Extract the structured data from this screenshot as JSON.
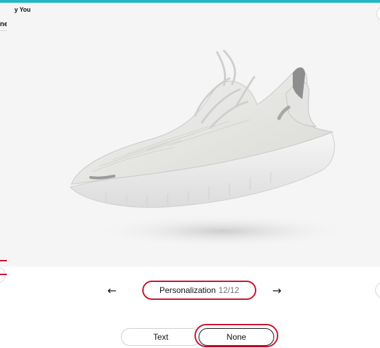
{
  "viewer": {
    "title": "y You",
    "right_control_glyph": "↺"
  },
  "left_panel": {
    "cropped_text": "ne"
  },
  "pager": {
    "prev_glyph": "←",
    "next_glyph": "→",
    "section_label": "Personalization",
    "section_count": "12/12"
  },
  "options": {
    "text_label": "Text",
    "none_label": "None"
  },
  "colors": {
    "accent_top": "#1fb8c4",
    "highlight": "#c8102e"
  }
}
